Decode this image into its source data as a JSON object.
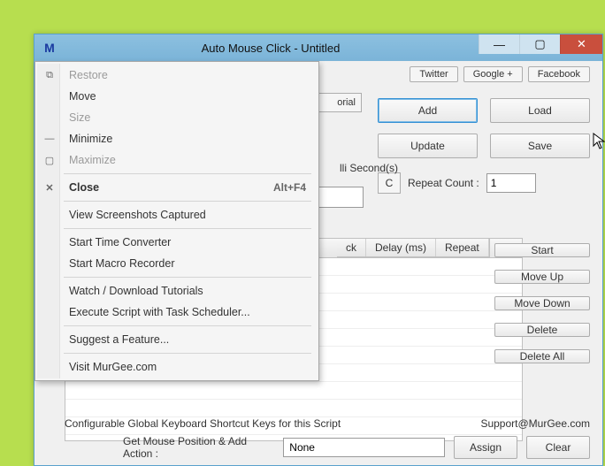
{
  "titlebar": {
    "icon_letter": "M",
    "title": "Auto Mouse Click - Untitled"
  },
  "links": {
    "twitter": "Twitter",
    "google": "Google +",
    "facebook": "Facebook"
  },
  "tutorial_fragment": "orial",
  "buttons": {
    "add": "Add",
    "load": "Load",
    "update": "Update",
    "save": "Save",
    "c": "C",
    "start": "Start",
    "moveup": "Move Up",
    "movedown": "Move Down",
    "delete": "Delete",
    "deleteall": "Delete All",
    "assign": "Assign",
    "clear": "Clear"
  },
  "labels": {
    "ms_units": "lli Second(s)",
    "repeat_count": "Repeat Count :",
    "repeat_value": "1",
    "config_line": "Configurable Global Keyboard Shortcut Keys for this Script",
    "support": "Support@MurGee.com",
    "getpos": "Get Mouse Position & Add Action :",
    "shortcut_value": "None"
  },
  "grid": {
    "headers": {
      "ck": "ck",
      "delay": "Delay (ms)",
      "repeat": "Repeat"
    }
  },
  "sysmenu": {
    "restore": "Restore",
    "move": "Move",
    "size": "Size",
    "minimize": "Minimize",
    "maximize": "Maximize",
    "close": "Close",
    "close_accel": "Alt+F4",
    "view_screens": "View Screenshots Captured",
    "start_time": "Start Time Converter",
    "start_macro": "Start Macro Recorder",
    "watch": "Watch / Download Tutorials",
    "execute": "Execute Script with Task Scheduler...",
    "suggest": "Suggest a Feature...",
    "visit": "Visit MurGee.com"
  }
}
